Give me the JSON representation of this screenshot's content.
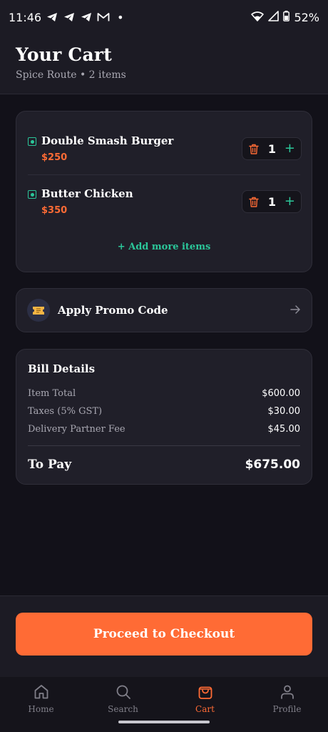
{
  "status_bar": {
    "time": "11:46",
    "notification_icons": [
      "telegram-icon",
      "telegram-icon",
      "telegram-icon",
      "gmail-icon"
    ],
    "dot": "•",
    "battery": "52%"
  },
  "header": {
    "title": "Your Cart",
    "subtitle": "Spice Route • 2 items"
  },
  "cart": {
    "items": [
      {
        "name": "Double Smash Burger",
        "price": "$250",
        "quantity": "1"
      },
      {
        "name": "Butter Chicken",
        "price": "$350",
        "quantity": "1"
      }
    ],
    "add_more_label": "+ Add more items"
  },
  "promo": {
    "label": "Apply Promo Code",
    "icon": "ticket-icon"
  },
  "bill": {
    "title": "Bill Details",
    "rows": [
      {
        "label": "Item Total",
        "value": "$600.00"
      },
      {
        "label": "Taxes (5% GST)",
        "value": "$30.00"
      },
      {
        "label": "Delivery Partner Fee",
        "value": "$45.00"
      }
    ],
    "to_pay_label": "To Pay",
    "to_pay_value": "$675.00"
  },
  "checkout": {
    "label": "Proceed to Checkout"
  },
  "nav": {
    "items": [
      {
        "label": "Home",
        "icon": "home-icon",
        "active": false
      },
      {
        "label": "Search",
        "icon": "search-icon",
        "active": false
      },
      {
        "label": "Cart",
        "icon": "cart-icon",
        "active": true
      },
      {
        "label": "Profile",
        "icon": "profile-icon",
        "active": false
      }
    ]
  },
  "colors": {
    "accent": "#ff6b35",
    "veg_green": "#2bc79a",
    "background": "#121119",
    "card": "#201f29"
  }
}
